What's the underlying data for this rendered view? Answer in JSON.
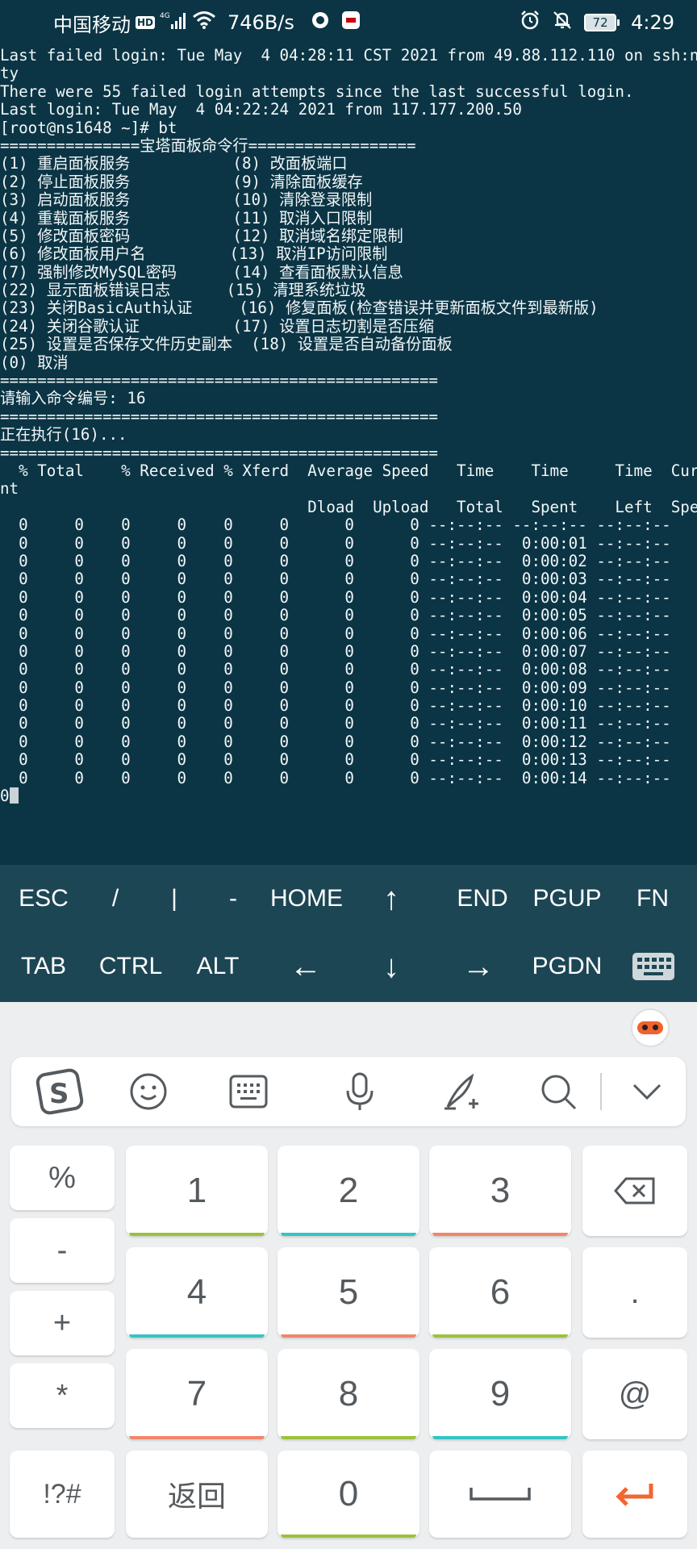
{
  "status_bar": {
    "carrier": "中国移动",
    "hd_badge": "HD",
    "network": "4G",
    "speed": "746B/s",
    "battery": "72",
    "time": "4:29"
  },
  "terminal": {
    "lines": [
      "Last failed login: Tue May  4 04:28:11 CST 2021 from 49.88.112.110 on ssh:not",
      "ty",
      "There were 55 failed login attempts since the last successful login.",
      "Last login: Tue May  4 04:22:24 2021 from 117.177.200.50",
      "[root@ns1648 ~]# bt",
      "===============宝塔面板命令行==================",
      "(1) 重启面板服务           (8) 改面板端口",
      "(2) 停止面板服务           (9) 清除面板缓存",
      "(3) 启动面板服务           (10) 清除登录限制",
      "(4) 重载面板服务           (11) 取消入口限制",
      "(5) 修改面板密码           (12) 取消域名绑定限制",
      "(6) 修改面板用户名         (13) 取消IP访问限制",
      "(7) 强制修改MySQL密码      (14) 查看面板默认信息",
      "(22) 显示面板错误日志      (15) 清理系统垃圾",
      "(23) 关闭BasicAuth认证     (16) 修复面板(检查错误并更新面板文件到最新版)",
      "(24) 关闭谷歌认证          (17) 设置日志切割是否压缩",
      "(25) 设置是否保存文件历史副本  (18) 设置是否自动备份面板",
      "(0) 取消",
      "===============================================",
      "请输入命令编号: 16",
      "===============================================",
      "正在执行(16)...",
      "===============================================",
      "  % Total    % Received % Xferd  Average Speed   Time    Time     Time  Curre",
      "nt",
      "                                 Dload  Upload   Total   Spent    Left  Speed",
      "  0     0    0     0    0     0      0      0 --:--:-- --:--:-- --:--:--",
      "  0     0    0     0    0     0      0      0 --:--:--  0:00:01 --:--:--",
      "  0     0    0     0    0     0      0      0 --:--:--  0:00:02 --:--:--",
      "  0     0    0     0    0     0      0      0 --:--:--  0:00:03 --:--:--",
      "  0     0    0     0    0     0      0      0 --:--:--  0:00:04 --:--:--",
      "  0     0    0     0    0     0      0      0 --:--:--  0:00:05 --:--:--",
      "  0     0    0     0    0     0      0      0 --:--:--  0:00:06 --:--:--",
      "  0     0    0     0    0     0      0      0 --:--:--  0:00:07 --:--:--",
      "  0     0    0     0    0     0      0      0 --:--:--  0:00:08 --:--:--",
      "  0     0    0     0    0     0      0      0 --:--:--  0:00:09 --:--:--",
      "  0     0    0     0    0     0      0      0 --:--:--  0:00:10 --:--:--",
      "  0     0    0     0    0     0      0      0 --:--:--  0:00:11 --:--:--",
      "  0     0    0     0    0     0      0      0 --:--:--  0:00:12 --:--:--",
      "  0     0    0     0    0     0      0      0 --:--:--  0:00:13 --:--:--",
      "  0     0    0     0    0     0      0      0 --:--:--  0:00:14 --:--:--",
      "0"
    ]
  },
  "extra_keys": {
    "row1": [
      "ESC",
      "/",
      "|",
      "-",
      "HOME",
      "↑",
      "END",
      "PGUP",
      "FN"
    ],
    "row2": [
      "TAB",
      "CTRL",
      "ALT",
      "←",
      "↓",
      "→",
      "PGDN"
    ],
    "keyboard_icon": "keyboard-icon"
  },
  "ime": {
    "toolbar_icons": [
      "sogou-logo-icon",
      "emoji-icon",
      "keyboard-icon",
      "microphone-icon",
      "handwriting-icon",
      "search-icon",
      "collapse-icon"
    ],
    "left_keys": [
      "%",
      "-",
      "+",
      "*",
      "!?#"
    ],
    "digits": [
      "1",
      "2",
      "3",
      "4",
      "5",
      "6",
      "7",
      "8",
      "9"
    ],
    "back_label": "返回",
    "zero": "0",
    "right_keys": [
      ".",
      "@"
    ],
    "colors": {
      "green": "#9bc23c",
      "cyan": "#36c4c4",
      "salmon": "#f0876a",
      "enter": "#f2662f"
    }
  }
}
